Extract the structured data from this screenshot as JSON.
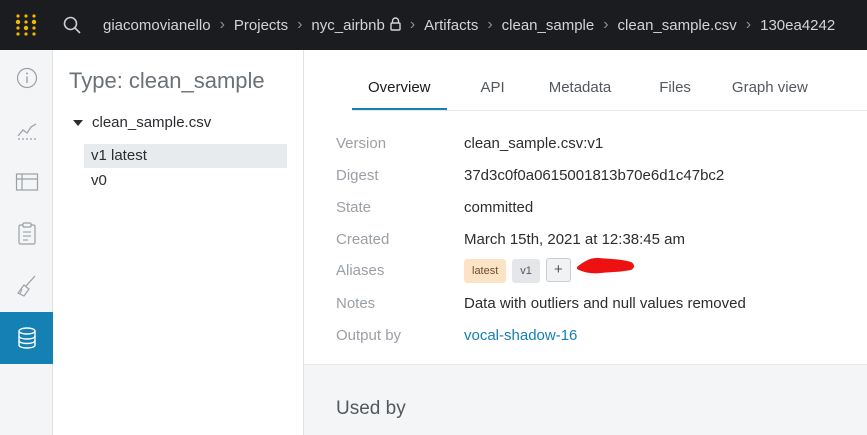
{
  "breadcrumbs": [
    {
      "label": "giacomovianello"
    },
    {
      "label": "Projects"
    },
    {
      "label": "nyc_airbnb",
      "locked": true
    },
    {
      "label": "Artifacts"
    },
    {
      "label": "clean_sample"
    },
    {
      "label": "clean_sample.csv"
    },
    {
      "label": "130ea4242"
    }
  ],
  "rail": {
    "icons": [
      "info-icon",
      "chart-icon",
      "table-icon",
      "clipboard-icon",
      "broom-icon",
      "database-icon"
    ],
    "active": "database-icon"
  },
  "panel": {
    "title": "Type: clean_sample",
    "tree_label": "clean_sample.csv",
    "versions": [
      {
        "label": "v1 latest",
        "selected": true
      },
      {
        "label": "v0",
        "selected": false
      }
    ]
  },
  "tabs": [
    "Overview",
    "API",
    "Metadata",
    "Files",
    "Graph view"
  ],
  "active_tab": "Overview",
  "details": {
    "version": {
      "key": "Version",
      "value": "clean_sample.csv:v1"
    },
    "digest": {
      "key": "Digest",
      "value": "37d3c0f0a0615001813b70e6d1c47bc2"
    },
    "state": {
      "key": "State",
      "value": "committed"
    },
    "created": {
      "key": "Created",
      "value": "March 15th, 2021 at 12:38:45 am"
    },
    "aliases": {
      "key": "Aliases",
      "values": [
        "latest",
        "v1"
      ],
      "add_label": "+"
    },
    "notes": {
      "key": "Notes",
      "value": "Data with outliers and null values removed"
    },
    "output_by": {
      "key": "Output by",
      "value": "vocal-shadow-16"
    }
  },
  "used_by": "Used by",
  "colors": {
    "accent": "#1580b4",
    "topbar": "#1a1c1f",
    "latest_badge": "#fce3c6",
    "annotation": "#ee1111"
  }
}
